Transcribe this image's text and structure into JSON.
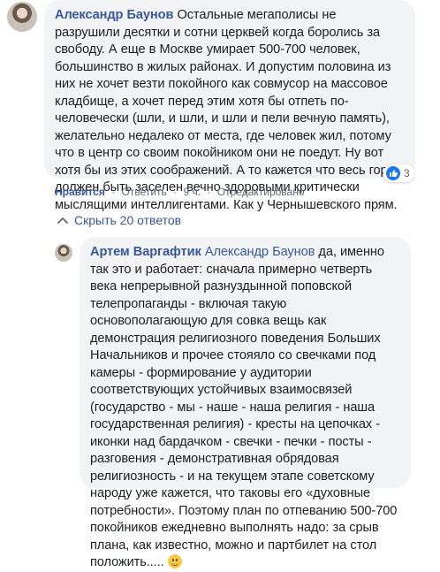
{
  "comment": {
    "author": "Александр Баунов",
    "text": "Остальные мегаполисы не разрушили десятки и сотни церквей когда боролись за свободу. А еще в Москве умирает 500-700 человек, большинство в жилых районах. И допустим половина из них не хочет везти покойного как совмусор на массовое кладбище, а хочет перед этим хотя бы отпеть по-человечески (шли, и шли, и шли и пели вечную память), желательно недалеко от места, где человек жил, потому что в центр со своим покойником они не поедут. Ну вот хотя бы из этих соображений. А то кажется что весь город должен быть заселен вечно здоровыми критически мыслящими интеллигентами. Как у Чернышевского прям.",
    "reaction_count": "3",
    "actions": {
      "like": "Нравится",
      "reply": "Ответить",
      "time": "9 ч.",
      "edited": "Отредактировано"
    }
  },
  "hide_replies_label": "Скрыть 20 ответов",
  "reply": {
    "author": "Артем Варгафтик",
    "mention": "Александр Баунов",
    "text": "да, именно так это и работает: сначала примерно четверть века непрерывной разнуздынной поповской телепропаганды - включая такую основополагающую для совка вещь как демонстрация религиозного поведения Больших Начальников и прочее стояяло со свечками под камеры - формирование у аудитории соответствующих устойчивых взаимосвязей (государство - мы - наше - наша религия - наша государственная религия) - кресты на цепочках - иконки над бардачком - свечки - печки - посты - разговения - демонстративная обрядовая религиозность - и на текущем этапе советскому народу уже кажется, что таковы его «духовные потребности». Поэтому план по отпеванию 500-700 покойников ежедневно выполнять надо: за срыв плана, как известно, можно и партбилет на стол положить....."
  },
  "icons": {
    "like_reaction": "like-icon",
    "chevron": "chevron-up-icon",
    "emoji": "smiling-face-icon"
  },
  "colors": {
    "link": "#385898",
    "bubble": "#f2f3f5",
    "like_blue": "#1877f2"
  }
}
